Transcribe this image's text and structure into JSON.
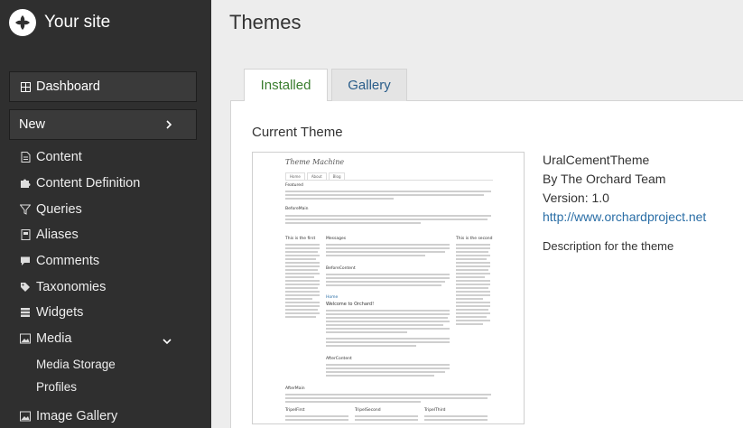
{
  "brand": {
    "title": "Your site"
  },
  "sidebar": {
    "dashboard": "Dashboard",
    "new": "New",
    "items": [
      {
        "label": "Content",
        "icon": "content-icon"
      },
      {
        "label": "Content Definition",
        "icon": "puzzle-icon"
      },
      {
        "label": "Queries",
        "icon": "filter-icon"
      },
      {
        "label": "Aliases",
        "icon": "alias-icon"
      },
      {
        "label": "Comments",
        "icon": "comments-icon"
      },
      {
        "label": "Taxonomies",
        "icon": "tags-icon"
      },
      {
        "label": "Widgets",
        "icon": "widgets-icon"
      },
      {
        "label": "Media",
        "icon": "image-icon"
      }
    ],
    "media_sub": [
      "Media Storage",
      "Profiles"
    ],
    "image_gallery": "Image Gallery"
  },
  "page": {
    "title": "Themes",
    "tabs": [
      "Installed",
      "Gallery"
    ],
    "active_tab": "Installed",
    "section_title": "Current Theme"
  },
  "theme": {
    "name": "UralCementTheme",
    "author": "By The Orchard Team",
    "version": "Version: 1.0",
    "url": "http://www.orchardproject.net",
    "description": "Description for the theme"
  },
  "preview": {
    "site_title": "Theme Machine",
    "nav": [
      "Home",
      "About",
      "Blog"
    ],
    "featured": "Featured",
    "before_main": "BeforeMain",
    "left_col": "This is the first",
    "messages": "Messages",
    "right_col": "This is the second",
    "before_content": "BeforeContent",
    "home_link": "Home",
    "welcome": "Welcome to Orchard!",
    "after_content": "AfterContent",
    "after_main": "AfterMain",
    "tripel": [
      "TripelFirst",
      "TripelSecond",
      "TripelThird"
    ]
  },
  "colors": {
    "sidebar_bg": "#2f2f2f",
    "active_tab_text": "#3a7d2e",
    "link": "#2a6ea6"
  }
}
